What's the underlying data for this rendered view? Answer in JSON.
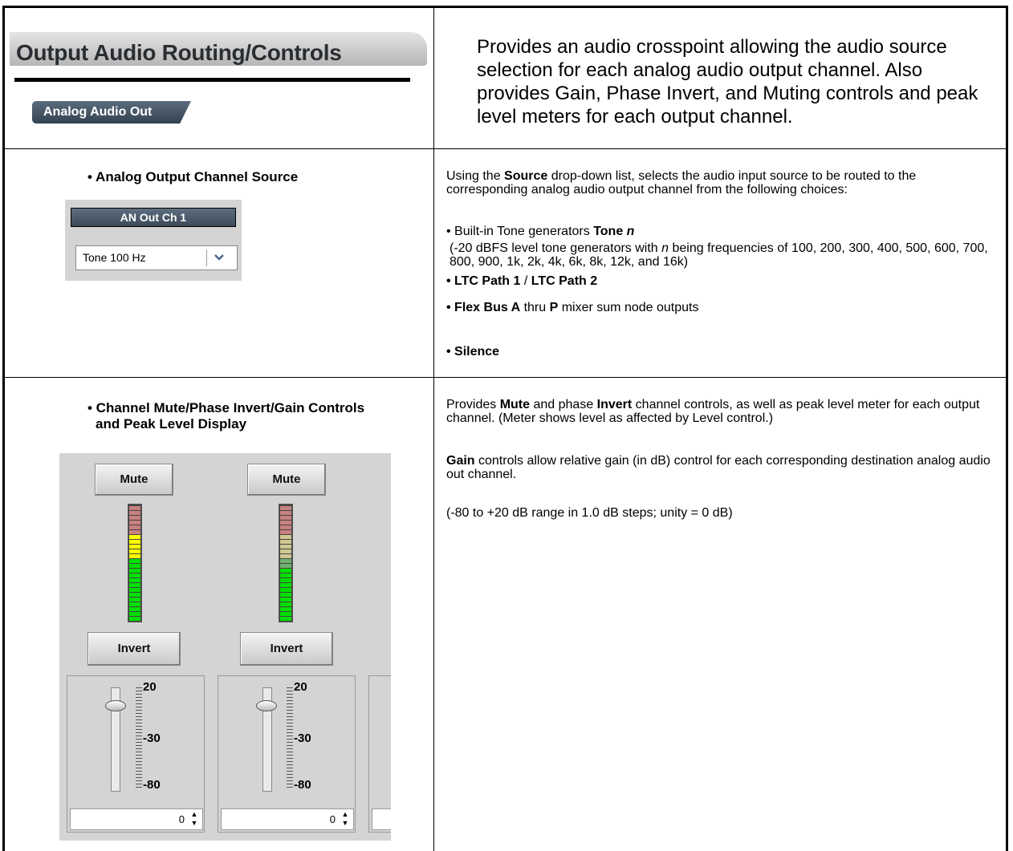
{
  "header": {
    "title": "Output Audio Routing/Controls",
    "subtab": "Analog Audio Out",
    "description": "Provides an audio crosspoint allowing the audio source selection for each analog audio output channel. Also provides Gain, Phase Invert, and Muting controls and peak level meters for each output channel."
  },
  "source_section": {
    "heading": "• Analog Output Channel Source",
    "channel_label": "AN Out Ch 1",
    "dropdown_value": "Tone 100 Hz",
    "intro_pre": "Using the ",
    "intro_bold": "Source",
    "intro_post": " drop-down list, selects the audio input source to be routed to the corresponding analog audio output channel from the following choices:",
    "item1_pre": "• Built-in Tone generators ",
    "item1_bold": "Tone ",
    "item1_italic": "n",
    "item1_detail_pre": "(-20 dBFS level tone generators with ",
    "item1_detail_italic": "n",
    "item1_detail_post": " being frequencies of 100, 200, 300, 400, 500, 600, 700, 800, 900, 1k, 2k, 4k, 6k, 8k, 12k, and 16k)",
    "item2_a": "• LTC Path 1",
    "item2_sep": " / ",
    "item2_b": "LTC Path 2",
    "item3_a": "• Flex Bus A",
    "item3_mid": " thru ",
    "item3_b": "P",
    "item3_post": " mixer sum node outputs",
    "item4": "• Silence"
  },
  "controls_section": {
    "heading_line1": "• Channel Mute/Phase Invert/Gain Controls",
    "heading_line2": "and Peak Level Display",
    "para1_pre": "Provides ",
    "para1_b1": "Mute",
    "para1_mid": " and phase ",
    "para1_b2": "Invert",
    "para1_post": " channel controls, as well as peak level meter for each output channel. (Meter shows level as affected by Level control.)",
    "para2_bold": "Gain",
    "para2_post": " controls allow relative gain (in dB) control for each corresponding destination analog audio out channel.",
    "para3": "(-80 to +20 dB range in 1.0 dB steps; unity = 0 dB)",
    "channels": [
      {
        "mute_label": "Mute",
        "invert_label": "Invert",
        "gain_value": "0",
        "scale_top": "20",
        "scale_mid": "-30",
        "scale_bot": "-80",
        "meter_level": 0.75
      },
      {
        "mute_label": "Mute",
        "invert_label": "Invert",
        "gain_value": "0",
        "scale_top": "20",
        "scale_mid": "-30",
        "scale_bot": "-80",
        "meter_level": 0.45
      }
    ]
  }
}
